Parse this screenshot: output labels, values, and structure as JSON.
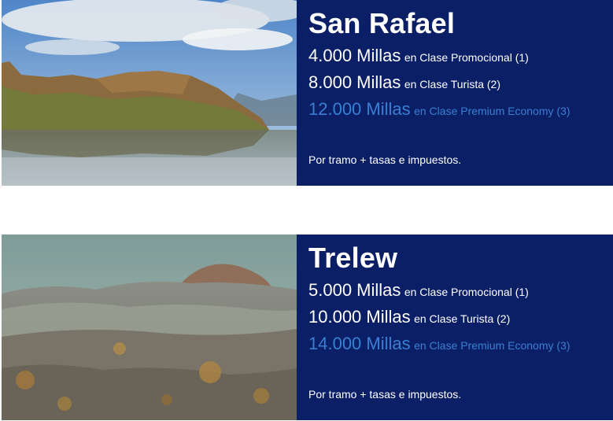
{
  "offers": [
    {
      "city": "San Rafael",
      "image_alt": "Lake with mountains and cloudy sky",
      "fares": [
        {
          "miles": "4.000 Millas",
          "cls": "en Clase Promocional (1)"
        },
        {
          "miles": "8.000 Millas",
          "cls": "en Clase Turista (2)"
        },
        {
          "miles": "12.000 Millas",
          "cls": "en Clase Premium Economy (3)"
        }
      ],
      "note": "Por tramo + tasas e impuestos."
    },
    {
      "city": "Trelew",
      "image_alt": "Arid Patagonian badlands landscape",
      "fares": [
        {
          "miles": "5.000 Millas",
          "cls": "en Clase Promocional (1)"
        },
        {
          "miles": "10.000 Millas",
          "cls": "en Clase Turista (2)"
        },
        {
          "miles": "14.000 Millas",
          "cls": "en Clase Premium Economy (3)"
        }
      ],
      "note": "Por tramo + tasas e impuestos."
    }
  ],
  "colors": {
    "panel_bg": "#0b1f66",
    "premium_text": "#3a7fd2",
    "text": "#ffffff"
  }
}
